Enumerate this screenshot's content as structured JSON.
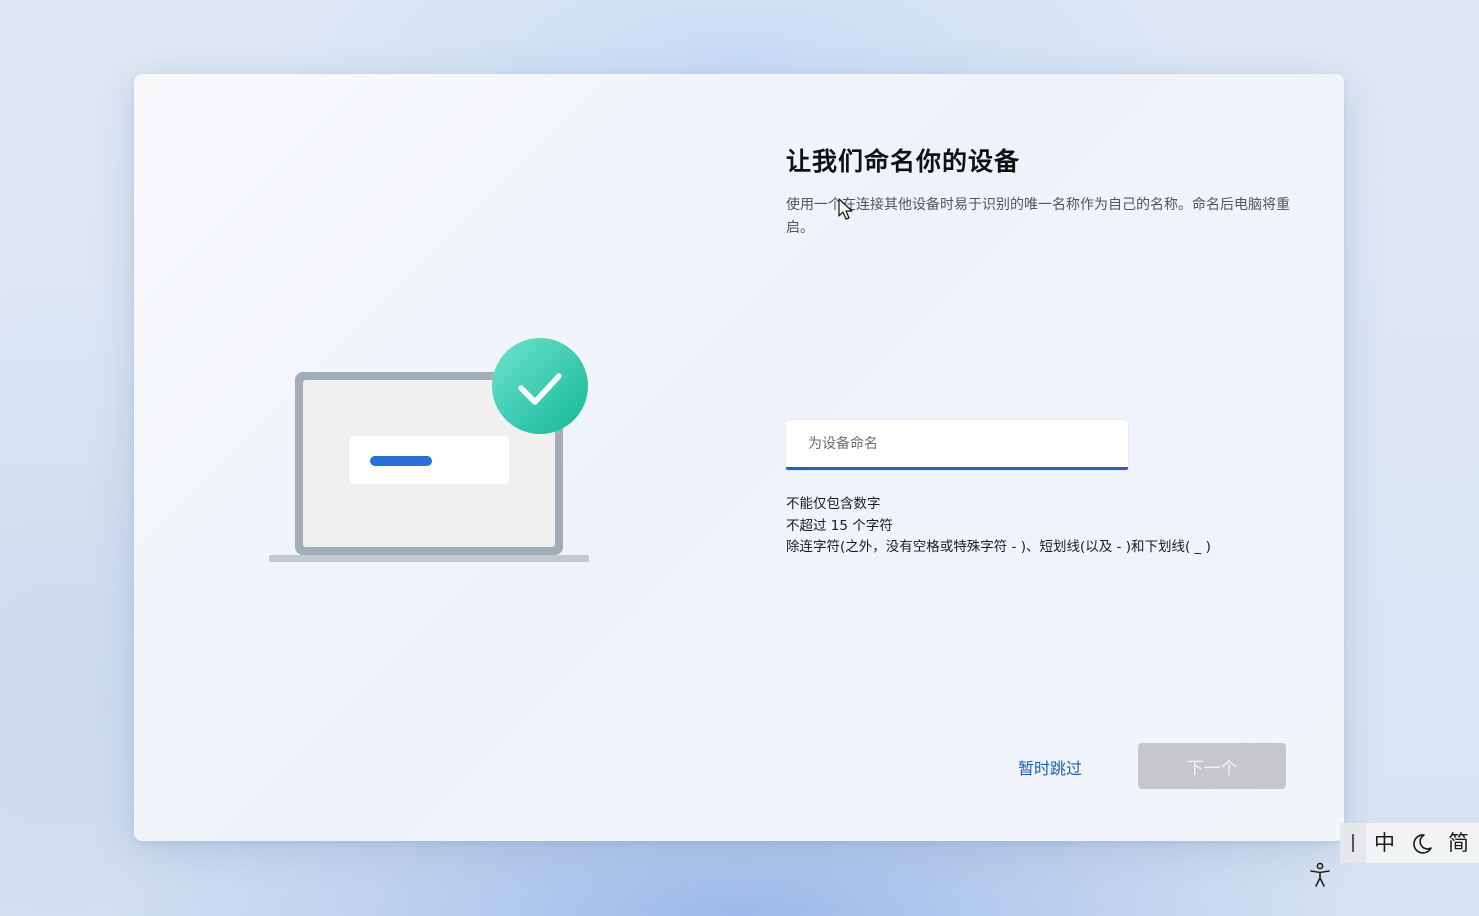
{
  "page": {
    "title": "让我们命名你的设备",
    "description": "使用一个在连接其他设备时易于识别的唯一名称作为自己的名称。命名后电脑将重启。"
  },
  "name_field": {
    "placeholder": "为设备命名",
    "value": ""
  },
  "rules": [
    "不能仅包含数字",
    "不超过 15 个字符",
    "除连字符(之外，没有空格或特殊字符 - )、短划线(以及 - )和下划线( _ )"
  ],
  "actions": {
    "skip_label": "暂时跳过",
    "next_label": "下一个"
  },
  "ime": {
    "mode": "中",
    "moon_icon": "moon-icon",
    "charset": "简"
  },
  "icons": {
    "laptop": "laptop-illustration",
    "check": "check-badge-icon",
    "accessibility": "accessibility-icon"
  },
  "colors": {
    "accent": "#1f64c2",
    "link": "#1a5fb4",
    "check_badge": "#2ec9a7",
    "next_disabled": "#c5c7ca"
  }
}
